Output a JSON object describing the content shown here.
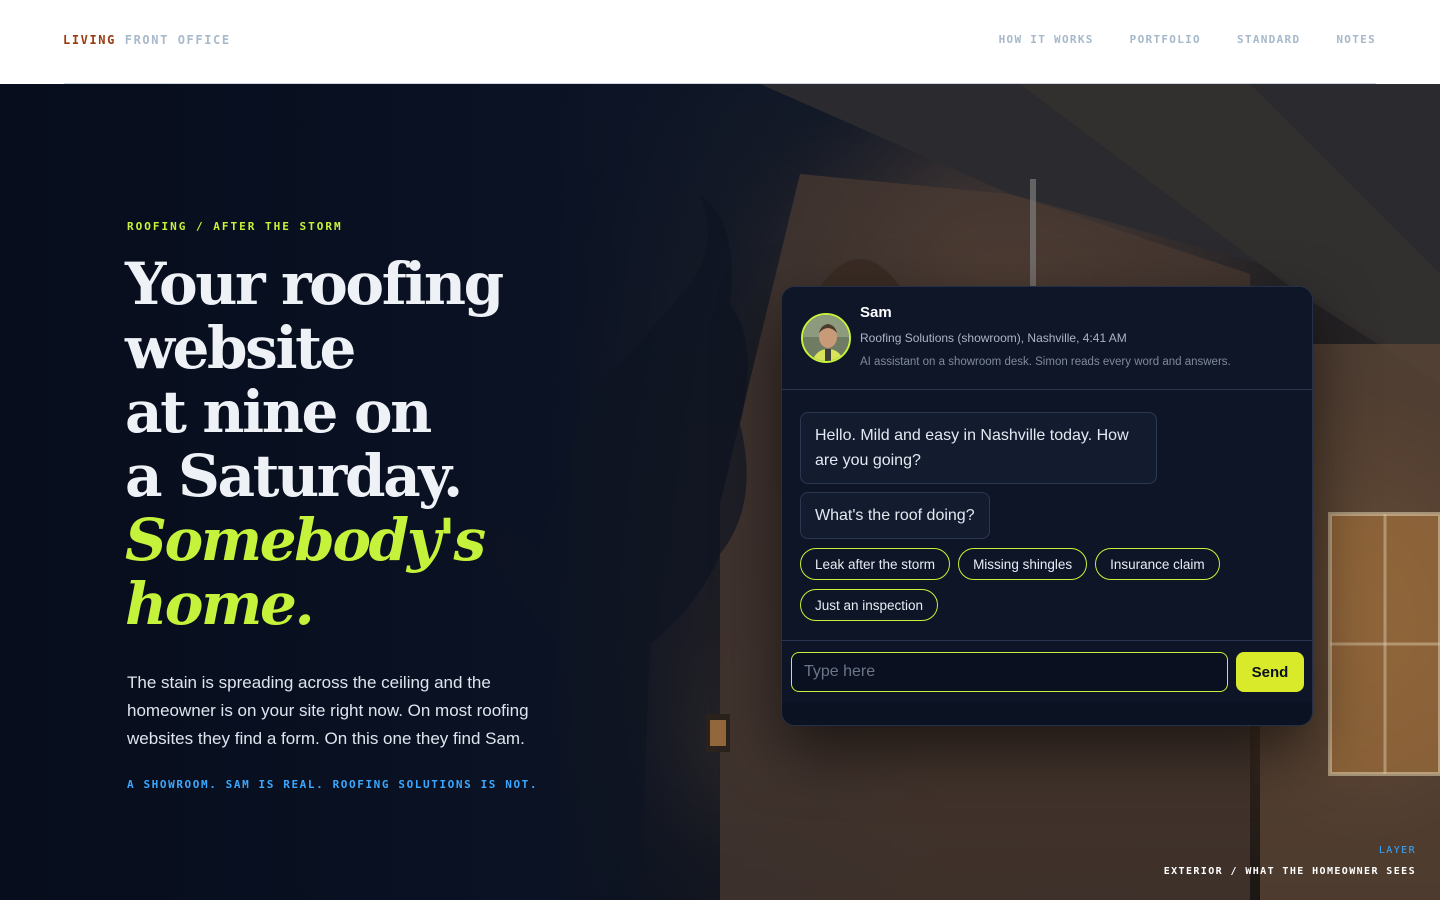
{
  "brand": {
    "part1": "LIVING",
    "part2": "FRONT OFFICE"
  },
  "nav": {
    "items": [
      "HOW IT WORKS",
      "PORTFOLIO",
      "STANDARD",
      "NOTES"
    ]
  },
  "hero": {
    "eyebrow": "ROOFING / AFTER THE STORM",
    "headline_lines": [
      "Your roofing",
      "website",
      "at nine on",
      "a Saturday."
    ],
    "headline_accent_lines": [
      "Somebody's",
      "home."
    ],
    "lede": "The stain is spreading across the ceiling and the homeowner is on your site right now. On most roofing websites they find a form. On this one they find Sam.",
    "disclaimer": "A SHOWROOM. SAM IS REAL. ROOFING SOLUTIONS IS NOT."
  },
  "layer": {
    "label": "LAYER",
    "value": "EXTERIOR / WHAT THE HOMEOWNER SEES"
  },
  "chat": {
    "agent_name": "Sam",
    "agent_meta": "Roofing Solutions (showroom), Nashville, 4:41 AM",
    "agent_note": "AI assistant on a showroom desk. Simon reads every word and answers.",
    "messages": [
      "Hello. Mild and easy in Nashville today. How are you going?",
      "What's the roof doing?"
    ],
    "quick_replies": [
      "Leak after the storm",
      "Missing shingles",
      "Insurance claim",
      "Just an inspection"
    ],
    "input_placeholder": "Type here",
    "send_label": "Send"
  },
  "colors": {
    "accent": "#c5f23a",
    "send_button": "#d9ea2a",
    "disclaimer_blue": "#3aa8ff",
    "brand_rust": "#9a3b12",
    "background": "#0b1020"
  },
  "icons": {
    "avatar": "sam-avatar-photo"
  }
}
